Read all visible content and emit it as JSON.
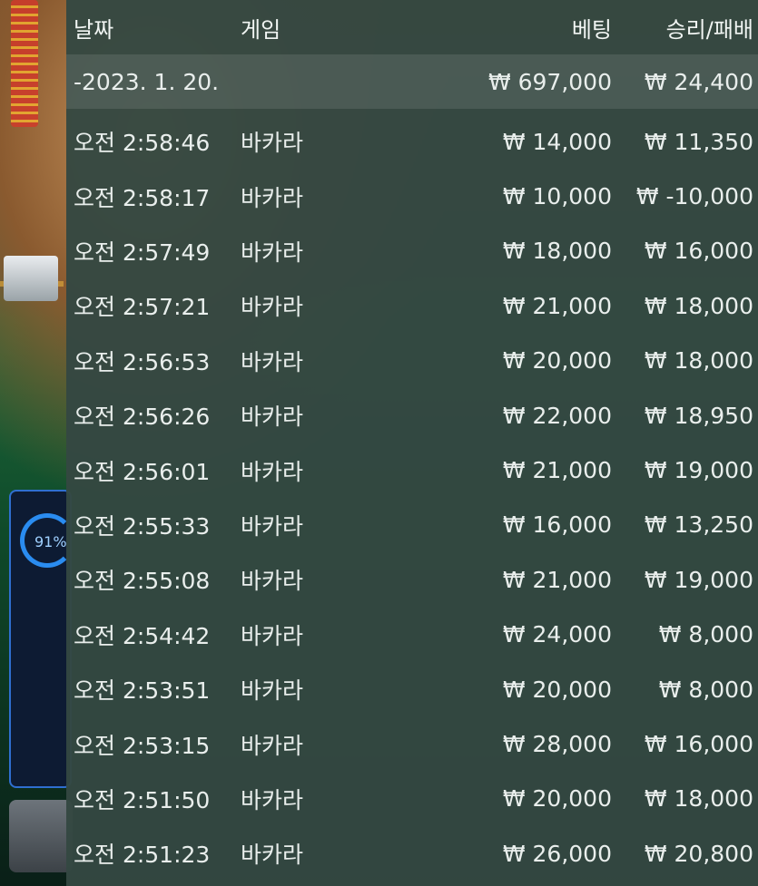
{
  "header": {
    "date": "날짜",
    "game": "게임",
    "bet": "베팅",
    "winloss": "승리/패배"
  },
  "summary": {
    "date": "-2023. 1. 20.",
    "bet": "₩ 697,000",
    "winloss": "₩ 24,400"
  },
  "rows": [
    {
      "time": "오전 2:58:46",
      "game": "바카라",
      "bet": "₩ 14,000",
      "winloss": "₩ 11,350"
    },
    {
      "time": "오전 2:58:17",
      "game": "바카라",
      "bet": "₩ 10,000",
      "winloss": "₩ -10,000"
    },
    {
      "time": "오전 2:57:49",
      "game": "바카라",
      "bet": "₩ 18,000",
      "winloss": "₩ 16,000"
    },
    {
      "time": "오전 2:57:21",
      "game": "바카라",
      "bet": "₩ 21,000",
      "winloss": "₩ 18,000"
    },
    {
      "time": "오전 2:56:53",
      "game": "바카라",
      "bet": "₩ 20,000",
      "winloss": "₩ 18,000"
    },
    {
      "time": "오전 2:56:26",
      "game": "바카라",
      "bet": "₩ 22,000",
      "winloss": "₩ 18,950"
    },
    {
      "time": "오전 2:56:01",
      "game": "바카라",
      "bet": "₩ 21,000",
      "winloss": "₩ 19,000"
    },
    {
      "time": "오전 2:55:33",
      "game": "바카라",
      "bet": "₩ 16,000",
      "winloss": "₩ 13,250"
    },
    {
      "time": "오전 2:55:08",
      "game": "바카라",
      "bet": "₩ 21,000",
      "winloss": "₩ 19,000"
    },
    {
      "time": "오전 2:54:42",
      "game": "바카라",
      "bet": "₩ 24,000",
      "winloss": "₩ 8,000"
    },
    {
      "time": "오전 2:53:51",
      "game": "바카라",
      "bet": "₩ 20,000",
      "winloss": "₩ 8,000"
    },
    {
      "time": "오전 2:53:15",
      "game": "바카라",
      "bet": "₩ 28,000",
      "winloss": "₩ 16,000"
    },
    {
      "time": "오전 2:51:50",
      "game": "바카라",
      "bet": "₩ 20,000",
      "winloss": "₩ 18,000"
    },
    {
      "time": "오전 2:51:23",
      "game": "바카라",
      "bet": "₩ 26,000",
      "winloss": "₩ 20,800"
    }
  ],
  "background": {
    "progress_label": "91%",
    "progress_value": 0.91
  }
}
